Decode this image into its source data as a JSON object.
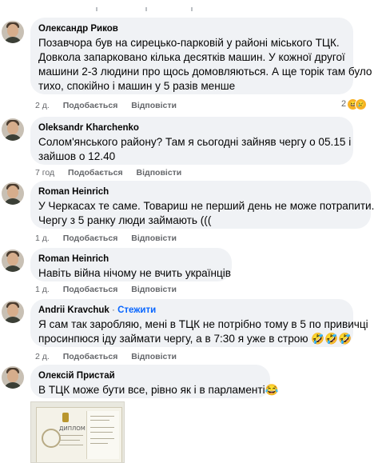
{
  "comments": [
    {
      "author": "Олександр Риков",
      "text_lines": [
        "Позавчора був на сирецько-парковій у районі міського ТЦК.",
        "Довкола запарковано кілька десятків машин. У кожної другої",
        "машини 2-3 людини про щось домовляються. А ще торік там було",
        "тихо, спокійно і машин у 5 разів менше"
      ],
      "time": "2 д.",
      "like_label": "Подобається",
      "reply_label": "Відповісти",
      "reactions_count": "2"
    },
    {
      "author": "Oleksandr Kharchenko",
      "text_lines": [
        "Солом'янського району? Там я сьогодні зайняв чергу о 05.15 і",
        "зайшов о 12.40"
      ],
      "time": "7 год",
      "like_label": "Подобається",
      "reply_label": "Відповісти"
    },
    {
      "author": "Roman Heinrich",
      "text_lines": [
        "У Черкасах те саме. Товариш не перший день не може потрапити.",
        "Чергу з 5 ранку люди займають ((("
      ],
      "time": "1 д.",
      "like_label": "Подобається",
      "reply_label": "Відповісти"
    },
    {
      "author": "Roman Heinrich",
      "text_lines": [
        "Навіть війна нічому не вчить українців"
      ],
      "time": "1 д.",
      "like_label": "Подобається",
      "reply_label": "Відповісти"
    },
    {
      "author": "Andrii Kravchuk",
      "follow_label": "Стежити",
      "text_lines": [
        "Я сам так заробляю, мені в ТЦК не потрібно тому в 5 по привичці",
        "просинпюся іду займати чергу, а в 7:30 я уже в строю 🤣🤣🤣"
      ],
      "time": "2 д.",
      "like_label": "Подобається",
      "reply_label": "Відповісти"
    },
    {
      "author": "Олексій Пристай",
      "text_lines": [
        "В ТЦК може бути все, рівно як і в парламенті😂"
      ]
    }
  ],
  "attachment": {
    "doc_title": "ДИПЛОМ МА"
  },
  "icons": [
    "avatar",
    "reaction-haha-icon",
    "reaction-sad-icon"
  ]
}
